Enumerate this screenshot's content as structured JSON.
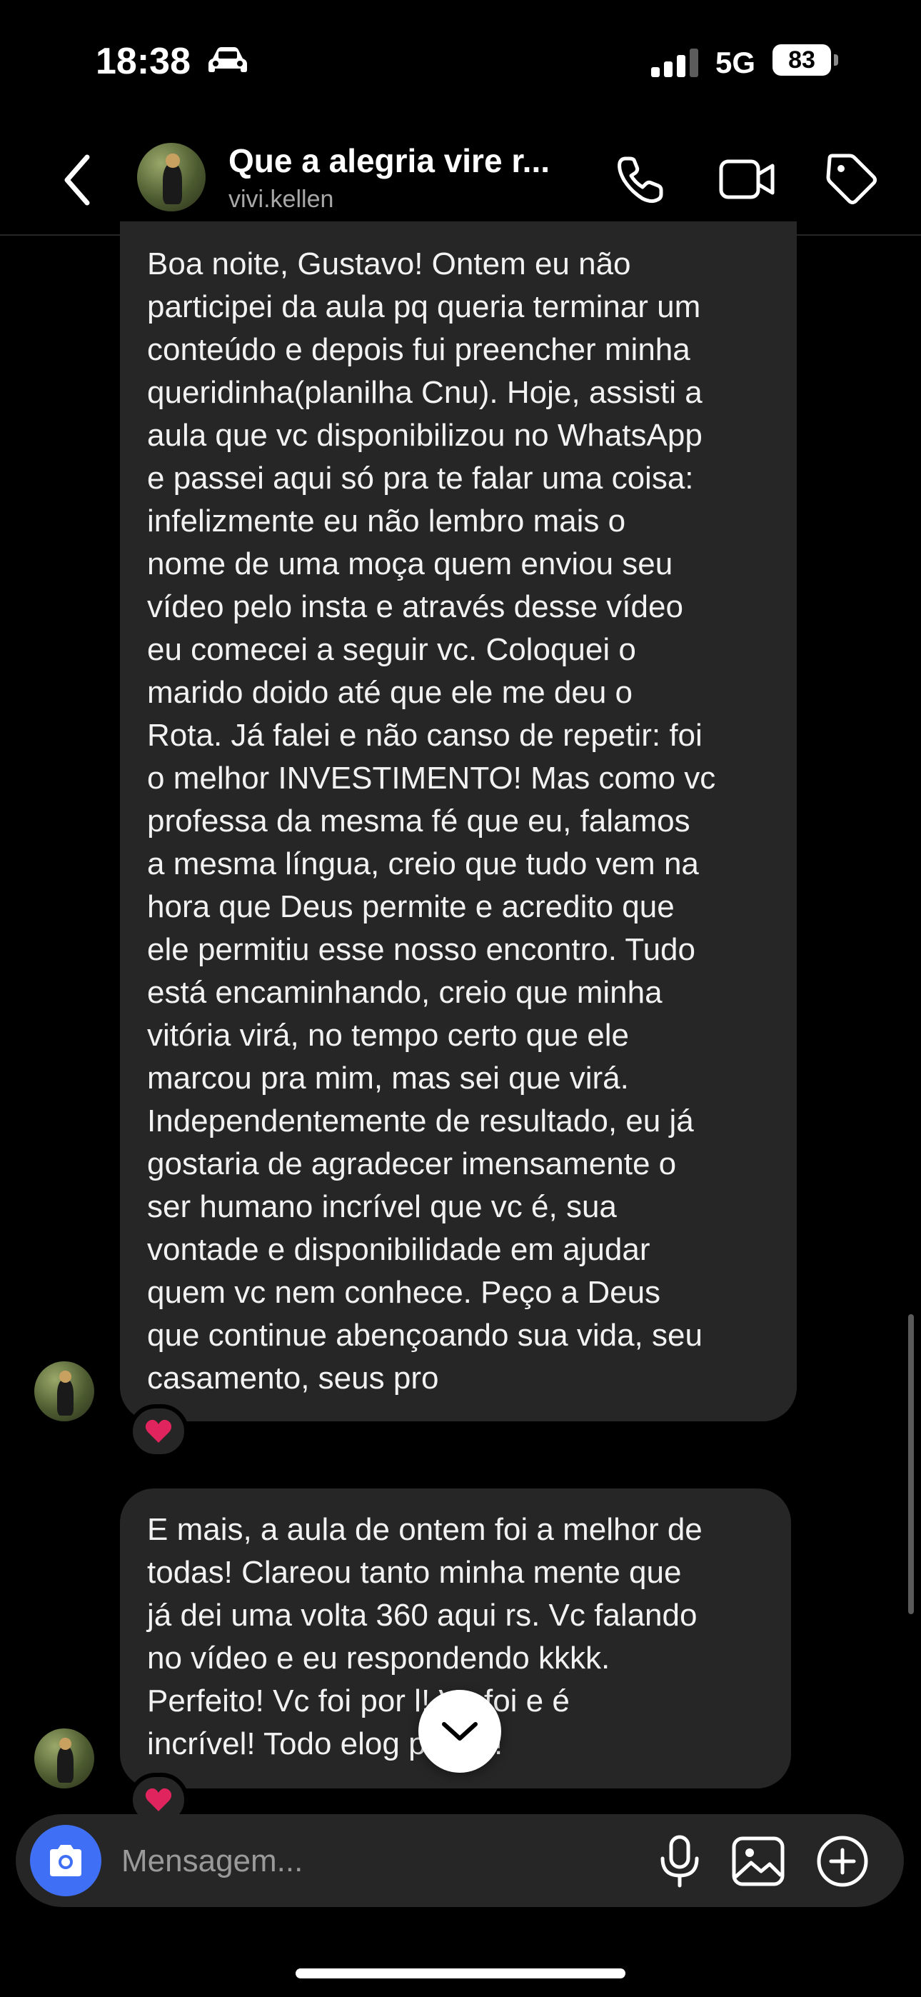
{
  "status_bar": {
    "time": "18:38",
    "network": "5G",
    "battery": "83"
  },
  "header": {
    "title": "Que a alegria vire r...",
    "username": "vivi.kellen"
  },
  "messages": [
    {
      "text": "Boa noite, Gustavo! Ontem eu não\nparticipei da aula pq queria terminar um\nconteúdo e depois fui preencher minha\nqueridinha(planilha Cnu). Hoje, assisti a\naula que vc disponibilizou no WhatsApp\ne passei aqui só pra te falar uma coisa:\ninfelizmente eu não lembro mais o\nnome de uma moça quem enviou seu\nvídeo pelo insta e através desse vídeo\neu comecei a seguir vc. Coloquei o\nmarido doido até que ele me deu o\nRota. Já falei e não canso de repetir: foi\no melhor INVESTIMENTO! Mas como vc\nprofessa da mesma fé que eu, falamos\na mesma língua, creio que tudo vem na\nhora que Deus permite e acredito que\nele permitiu esse nosso encontro. Tudo\nestá encaminhando, creio que minha\nvitória virá, no tempo certo que ele\nmarcou pra mim, mas sei que virá.\nIndependentemente de resultado, eu já\ngostaria de agradecer imensamente o\nser humano incrível que vc é, sua\nvontade e disponibilidade em ajudar\nquem vc nem conhece. Peço a Deus\nque continue abençoando sua vida, seu\ncasamento, seus pro",
      "reaction": "heart"
    },
    {
      "text": "E mais, a aula de ontem foi a melhor de\ntodas! Clareou tanto minha mente que\njá dei uma volta 360 aqui rs. Vc falando\nno vídeo e eu respondendo kkkk.\nPerfeito! Vc foi por     l! Vc foi e é\nincrível! Todo elog      pouco!",
      "reaction": "heart"
    }
  ],
  "composer": {
    "placeholder": "Mensagem..."
  },
  "colors": {
    "background": "#000000",
    "bubble": "#262626",
    "camera_button": "#3f6ff5",
    "heart": "#e0245e"
  },
  "icons": [
    "car-icon",
    "signal-icon",
    "back-arrow-icon",
    "phone-icon",
    "video-camera-icon",
    "tag-icon",
    "heart-icon",
    "chevron-down-icon",
    "camera-icon",
    "microphone-icon",
    "gallery-icon",
    "plus-circle-icon"
  ]
}
